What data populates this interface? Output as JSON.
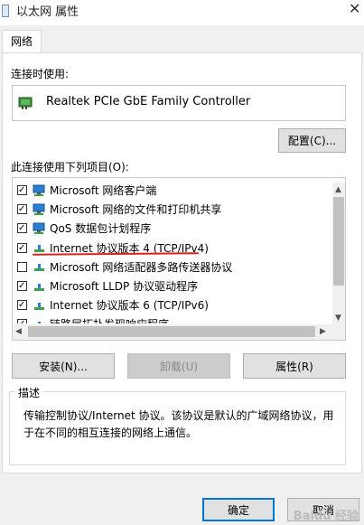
{
  "window": {
    "title": "以太网 属性",
    "close_glyph": "✕"
  },
  "tabs": [
    {
      "label": "网络"
    }
  ],
  "connect_using": {
    "label": "连接时使用:",
    "adapter_name": "Realtek PCIe GbE Family Controller",
    "configure_button": "配置(C)..."
  },
  "items_section": {
    "label": "此连接使用下列项目(O):",
    "items": [
      {
        "label": "Microsoft 网络客户端",
        "checked": true,
        "icon": "network-client-icon"
      },
      {
        "label": "Microsoft 网络的文件和打印机共享",
        "checked": true,
        "icon": "network-client-icon"
      },
      {
        "label": "QoS 数据包计划程序",
        "checked": true,
        "icon": "network-client-icon"
      },
      {
        "label": "Internet 协议版本 4 (TCP/IPv4)",
        "checked": true,
        "icon": "protocol-icon",
        "highlight_color": "#e02020"
      },
      {
        "label": "Microsoft 网络适配器多路传送器协议",
        "checked": false,
        "icon": "protocol-icon"
      },
      {
        "label": "Microsoft LLDP 协议驱动程序",
        "checked": true,
        "icon": "protocol-icon"
      },
      {
        "label": "Internet 协议版本 6 (TCP/IPv6)",
        "checked": true,
        "icon": "protocol-icon"
      },
      {
        "label": "链路层拓扑发现响应程序",
        "checked": true,
        "icon": "protocol-icon"
      }
    ]
  },
  "buttons": {
    "install": "安装(N)...",
    "uninstall": "卸载(U)",
    "properties": "属性(R)",
    "ok": "确定",
    "cancel": "取消"
  },
  "description": {
    "legend": "描述",
    "text_line1": "传输控制协议/Internet 协议。该协议是默认的广域网络协议，用",
    "text_line2": "于在不同的相互连接的网络上通信。"
  },
  "watermark": "Baidu 经验",
  "colors": {
    "accent": "#0078d7",
    "icon_blue": "#2a7fd4",
    "icon_green": "#3aa34a",
    "highlight": "#e02020"
  }
}
